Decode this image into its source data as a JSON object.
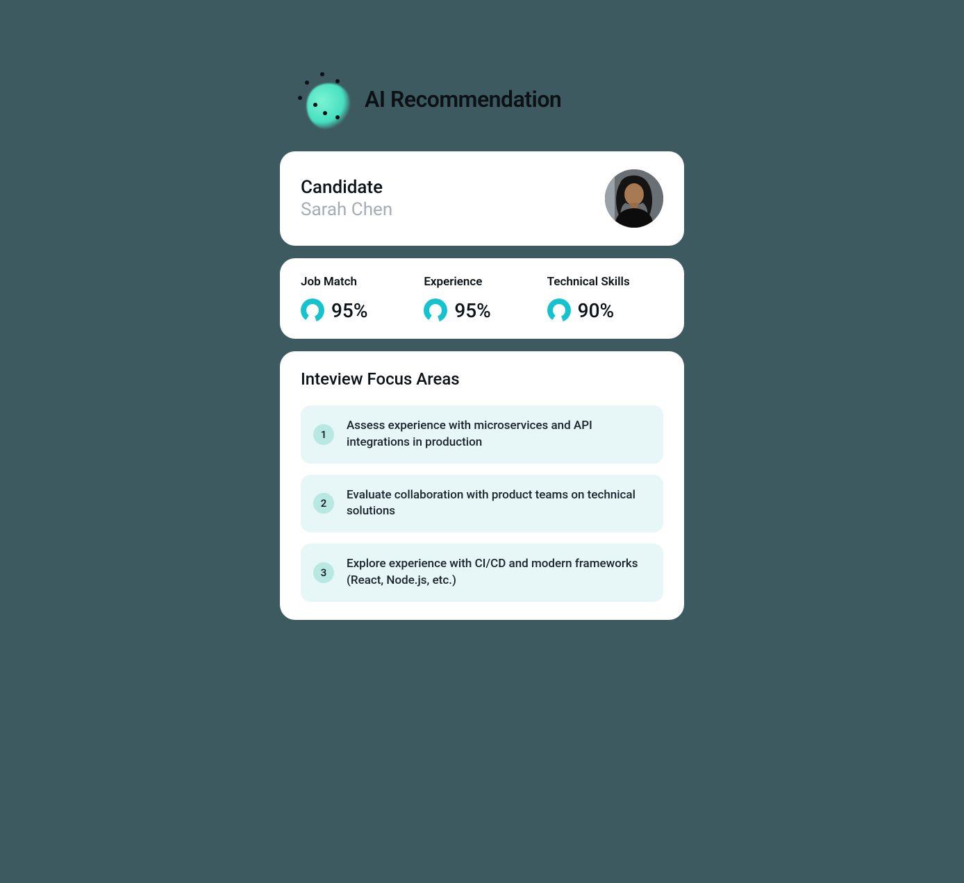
{
  "header": {
    "title": "AI Recommendation"
  },
  "candidate": {
    "label": "Candidate",
    "name": "Sarah Chen"
  },
  "metrics": [
    {
      "label": "Job Match",
      "value": "95%"
    },
    {
      "label": "Experience",
      "value": "95%"
    },
    {
      "label": "Technical Skills",
      "value": "90%"
    }
  ],
  "focus": {
    "title": "Inteview Focus Areas",
    "items": [
      {
        "num": "1",
        "text": "Assess experience with microservices and API integrations in production"
      },
      {
        "num": "2",
        "text": "Evaluate collaboration with product teams on technical solutions"
      },
      {
        "num": "3",
        "text": "Explore experience with CI/CD and modern frameworks (React, Node.js, etc.)"
      }
    ]
  }
}
